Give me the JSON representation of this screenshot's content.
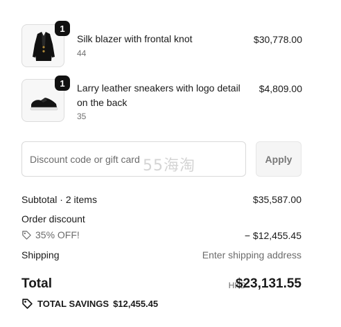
{
  "items": [
    {
      "name": "Silk blazer with frontal knot",
      "variant": "44",
      "price": "$30,778.00",
      "quantity": "1",
      "image_icon": "blazer-image"
    },
    {
      "name_line1": "Larry leather sneakers with logo detail",
      "name_line2": "on the back",
      "variant": "35",
      "price": "$4,809.00",
      "quantity": "1",
      "image_icon": "sneaker-image"
    }
  ],
  "discount": {
    "placeholder": "Discount code or gift card",
    "apply_label": "Apply",
    "watermark": "55海淘"
  },
  "summary": {
    "subtotal_label": "Subtotal · 2 items",
    "subtotal_value": "$35,587.00",
    "order_discount_label": "Order discount",
    "promo_label": "35% OFF!",
    "promo_value": "− $12,455.45",
    "shipping_label": "Shipping",
    "shipping_value": "Enter shipping address",
    "total_label": "Total",
    "currency": "HKD",
    "total_value": "$23,131.55",
    "savings_label": "TOTAL SAVINGS",
    "savings_value": "$12,455.45"
  }
}
